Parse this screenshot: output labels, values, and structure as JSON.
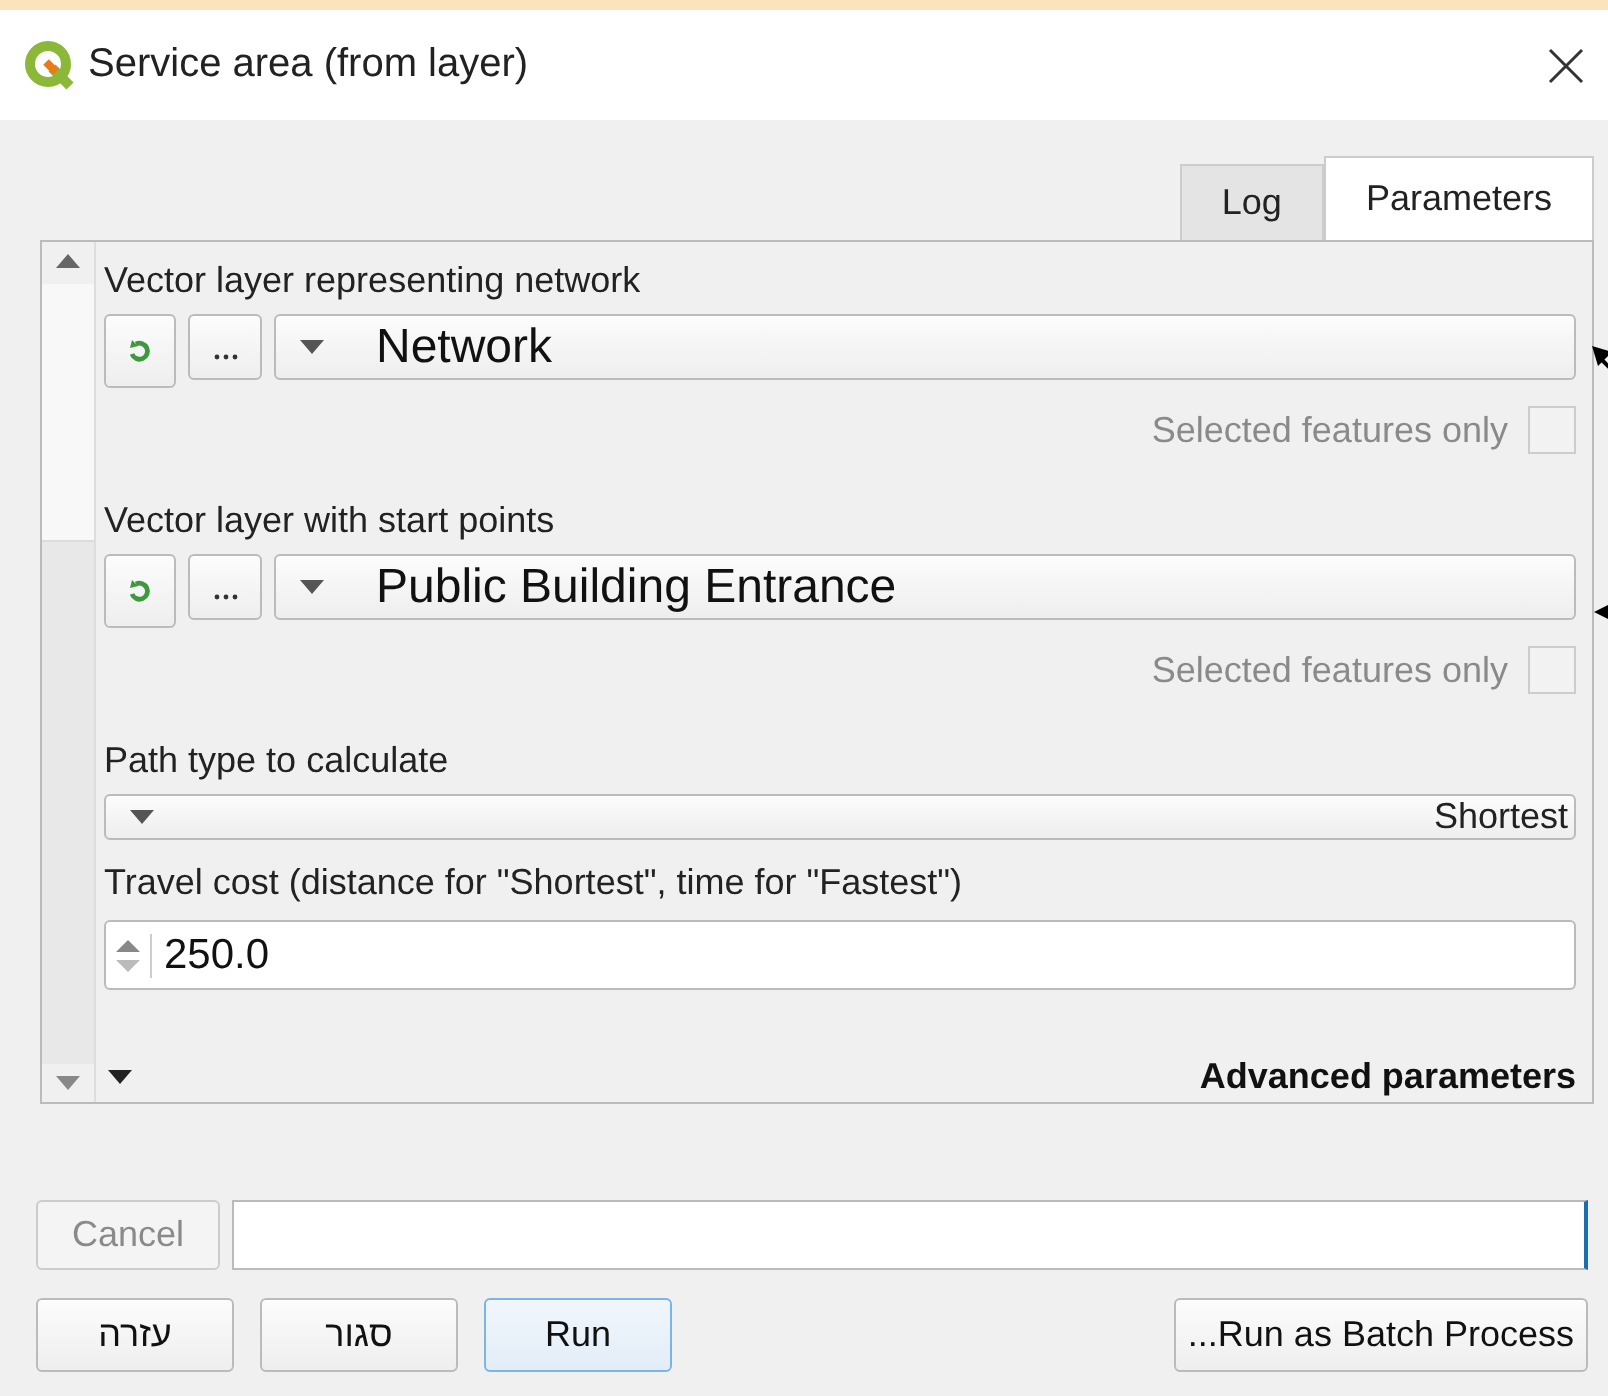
{
  "window": {
    "title": "Service area (from layer)"
  },
  "tabs": [
    {
      "label": "Log",
      "selected": false
    },
    {
      "label": "Parameters",
      "selected": true
    }
  ],
  "parameters": [
    {
      "kind": "layer",
      "label": "Vector layer representing network",
      "value": "Network",
      "selected_only": {
        "label": "Selected features only",
        "checked": false,
        "disabled": true
      }
    },
    {
      "kind": "layer",
      "label": "Vector layer with start points",
      "value": "Public Building Entrance",
      "selected_only": {
        "label": "Selected features only",
        "checked": false,
        "disabled": true
      }
    },
    {
      "kind": "combo",
      "label": "Path type to calculate",
      "value": "Shortest"
    },
    {
      "kind": "number",
      "label": "Travel cost (distance for \"Shortest\", time for \"Fastest\")",
      "value": "250.0"
    }
  ],
  "advanced": {
    "label": "Advanced parameters",
    "expanded": false
  },
  "progress": {
    "level": 0
  },
  "cancel_button": {
    "label": "Cancel",
    "disabled": true
  },
  "buttons": [
    {
      "label": "עזרה",
      "default": false
    },
    {
      "label": "סגור",
      "default": false
    },
    {
      "label": "Run",
      "default": true
    },
    {
      "kind": "batch",
      "label": "...Run as Batch Process",
      "default": false
    }
  ]
}
